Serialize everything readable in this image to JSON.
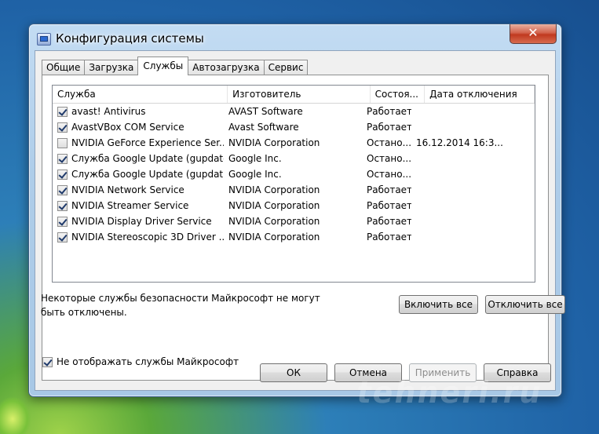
{
  "window": {
    "title": "Конфигурация системы",
    "close_glyph": "✕"
  },
  "tabs": [
    {
      "label": "Общие",
      "active": false
    },
    {
      "label": "Загрузка",
      "active": false
    },
    {
      "label": "Службы",
      "active": true
    },
    {
      "label": "Автозагрузка",
      "active": false
    },
    {
      "label": "Сервис",
      "active": false
    }
  ],
  "table": {
    "headers": [
      "Служба",
      "Изготовитель",
      "Состоя...",
      "Дата отключения"
    ],
    "rows": [
      {
        "checked": true,
        "name": "avast! Antivirus",
        "vendor": "AVAST Software",
        "state": "Работает",
        "date": ""
      },
      {
        "checked": true,
        "name": "AvastVBox COM Service",
        "vendor": "Avast Software",
        "state": "Работает",
        "date": ""
      },
      {
        "checked": false,
        "name": "NVIDIA GeForce Experience Ser...",
        "vendor": "NVIDIA Corporation",
        "state": "Остано...",
        "date": "16.12.2014 16:3..."
      },
      {
        "checked": true,
        "name": "Служба Google Update (gupdate)",
        "vendor": "Google Inc.",
        "state": "Остано...",
        "date": ""
      },
      {
        "checked": true,
        "name": "Служба Google Update (gupdat...",
        "vendor": "Google Inc.",
        "state": "Остано...",
        "date": ""
      },
      {
        "checked": true,
        "name": "NVIDIA Network Service",
        "vendor": "NVIDIA Corporation",
        "state": "Работает",
        "date": ""
      },
      {
        "checked": true,
        "name": "NVIDIA Streamer Service",
        "vendor": "NVIDIA Corporation",
        "state": "Работает",
        "date": ""
      },
      {
        "checked": true,
        "name": "NVIDIA Display Driver Service",
        "vendor": "NVIDIA Corporation",
        "state": "Работает",
        "date": ""
      },
      {
        "checked": true,
        "name": "NVIDIA Stereoscopic 3D Driver ...",
        "vendor": "NVIDIA Corporation",
        "state": "Работает",
        "date": ""
      }
    ]
  },
  "note": "Некоторые службы безопасности Майкрософт не могут быть отключены.",
  "buttons": {
    "enable_all": "Включить все",
    "disable_all": "Отключить все",
    "ok": "ОК",
    "cancel": "Отмена",
    "apply": "Применить",
    "help": "Справка"
  },
  "hide_ms": {
    "label": "Не отображать службы Майкрософт",
    "checked": true
  },
  "watermark": "tehneri.ru"
}
